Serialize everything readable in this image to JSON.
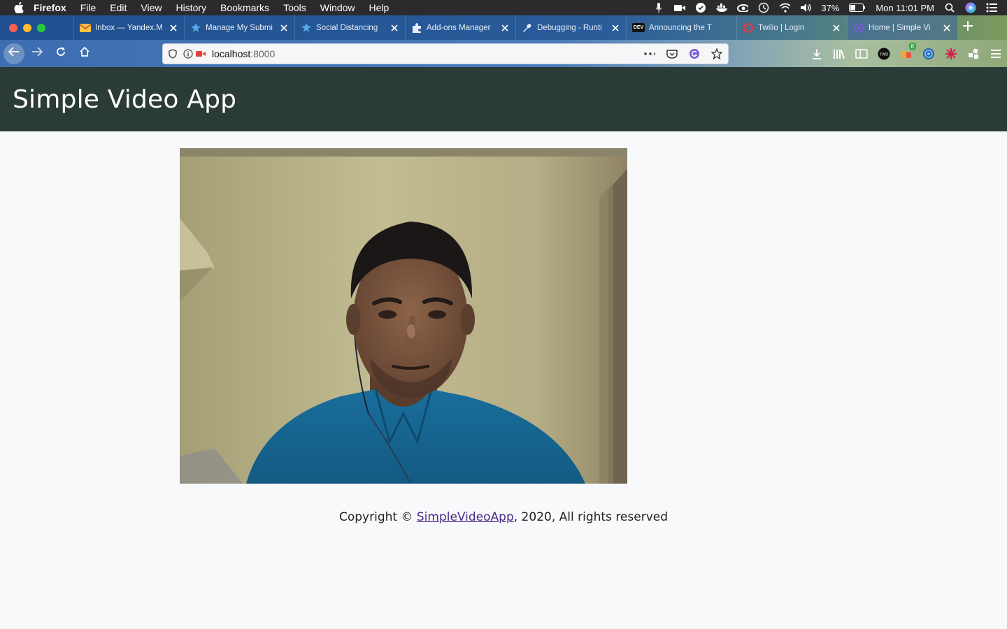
{
  "menubar": {
    "app_name": "Firefox",
    "items": [
      "File",
      "Edit",
      "View",
      "History",
      "Bookmarks",
      "Tools",
      "Window",
      "Help"
    ],
    "battery": "37%",
    "clock": "Mon 11:01 PM"
  },
  "tabs": [
    {
      "title": "Inbox — Yandex.M",
      "icon": "mail-icon"
    },
    {
      "title": "Manage My Submi",
      "icon": "puzzle-blue-icon"
    },
    {
      "title": "Social Distancing",
      "icon": "puzzle-blue-icon"
    },
    {
      "title": "Add-ons Manager",
      "icon": "puzzle-icon"
    },
    {
      "title": "Debugging - Runti",
      "icon": "wrench-icon"
    },
    {
      "title": "Announcing the T",
      "icon": "dev-icon",
      "favicon_text": "DEV"
    },
    {
      "title": "Twilio | Login",
      "icon": "twilio-icon"
    },
    {
      "title": "Home | Simple Vi",
      "icon": "app-icon",
      "active": true
    }
  ],
  "navbar": {
    "url_host": "localhost",
    "url_port": ":8000"
  },
  "page": {
    "title": "Simple Video App",
    "footer_prefix": "Copyright © ",
    "footer_link": "SimpleVideoApp",
    "footer_suffix": ", 2020, All rights reserved"
  },
  "colors": {
    "header_bg": "#2b3b37",
    "page_bg": "#f8f9fa",
    "link": "#4b2a8a"
  }
}
